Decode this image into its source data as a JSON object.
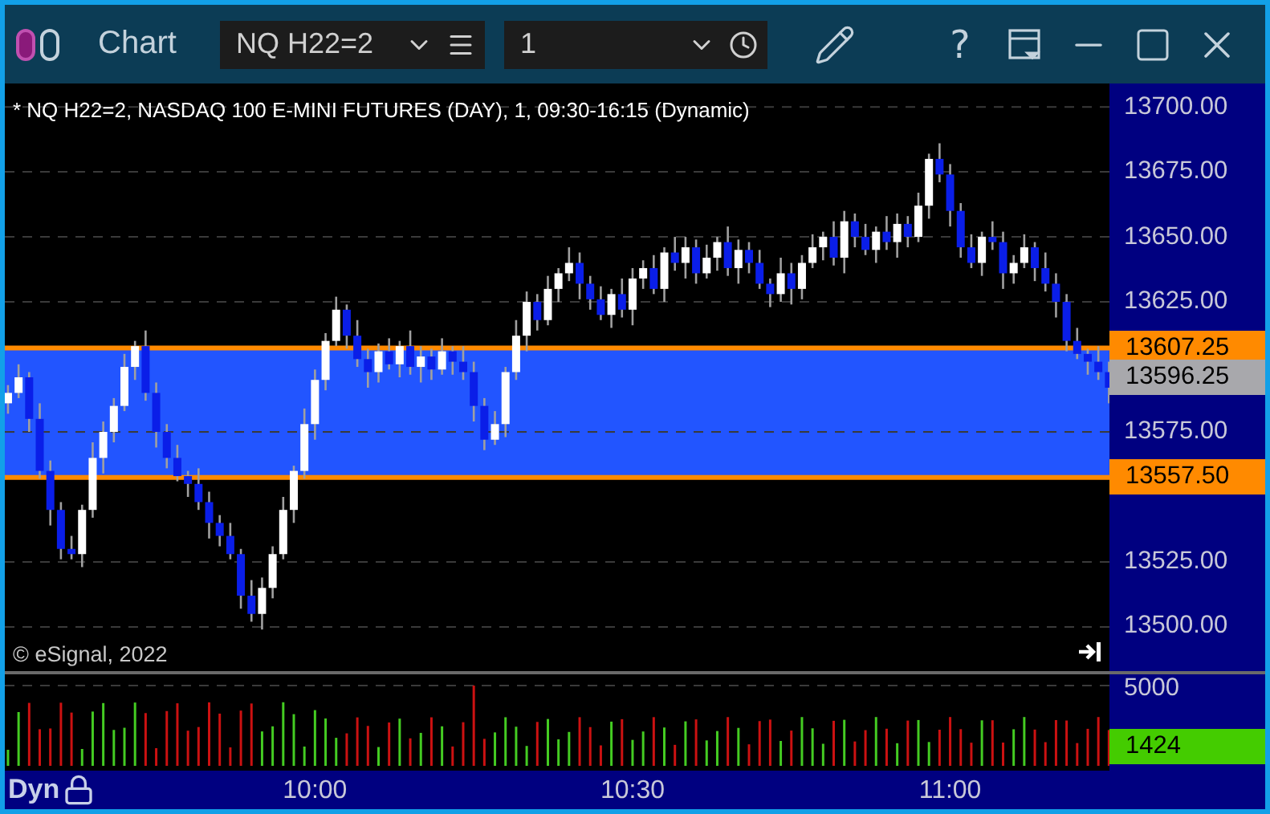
{
  "window": {
    "title": "Chart",
    "help": "?"
  },
  "symbol_field": {
    "value": "NQ H22=2"
  },
  "interval_field": {
    "value": "1"
  },
  "chart": {
    "legend": "* NQ H22=2, NASDAQ 100 E-MINI FUTURES (DAY), 1, 09:30-16:15 (Dynamic)",
    "copyright": "© eSignal, 2022",
    "price_labels": [
      {
        "text": "13607.25",
        "kind": "band"
      },
      {
        "text": "13596.25",
        "kind": "last"
      },
      {
        "text": "13557.50",
        "kind": "band"
      }
    ],
    "chart_data": {
      "type": "candlestick",
      "ylim": [
        13483,
        13709
      ],
      "grid": true,
      "bands": [
        {
          "axis": "y",
          "from": 13557.5,
          "to": 13607.25,
          "color": "#2255ff"
        }
      ],
      "ref_lines": [
        {
          "axis": "y",
          "value": 13607.25,
          "color": "#ff8a00"
        },
        {
          "axis": "y",
          "value": 13557.5,
          "color": "#ff8a00"
        }
      ],
      "yticks": [
        {
          "value": 13700,
          "label": "13700.00"
        },
        {
          "value": 13675,
          "label": "13675.00"
        },
        {
          "value": 13650,
          "label": "13650.00"
        },
        {
          "value": 13625,
          "label": "13625.00"
        },
        {
          "value": 13575,
          "label": "13575.00"
        },
        {
          "value": 13525,
          "label": "13525.00"
        },
        {
          "value": 13500,
          "label": "13500.00"
        }
      ],
      "categories": [
        null,
        null,
        null,
        null,
        null,
        null,
        null,
        null,
        null,
        null,
        null,
        null,
        null,
        null,
        null,
        null,
        null,
        null,
        null,
        null,
        null,
        null,
        null,
        null,
        null,
        null,
        null,
        null,
        null,
        null,
        null,
        null,
        null,
        null,
        null,
        null,
        null,
        null,
        null,
        null,
        null,
        null,
        null,
        null,
        null,
        null,
        null,
        null,
        null,
        null,
        null,
        null,
        null,
        null,
        null,
        null,
        null,
        null,
        null,
        null,
        null,
        null,
        null,
        null,
        null,
        null,
        null,
        null,
        null,
        null,
        null,
        null,
        null,
        null,
        null,
        null,
        null,
        null,
        null,
        null,
        null,
        null,
        null,
        null,
        null,
        null,
        null,
        null,
        null,
        null,
        null,
        null,
        null,
        null,
        null,
        null,
        null,
        null,
        null,
        null,
        null,
        null,
        null,
        null,
        null
      ],
      "ohlc": [
        [
          13586,
          13593,
          13582,
          13590
        ],
        [
          13590,
          13601,
          13588,
          13596
        ],
        [
          13596,
          13598,
          13575,
          13580
        ],
        [
          13580,
          13586,
          13557,
          13560
        ],
        [
          13560,
          13564,
          13539,
          13545
        ],
        [
          13545,
          13548,
          13526,
          13530
        ],
        [
          13530,
          13535,
          13526,
          13528
        ],
        [
          13528,
          13547,
          13523,
          13545
        ],
        [
          13545,
          13571,
          13542,
          13565
        ],
        [
          13565,
          13579,
          13559,
          13575
        ],
        [
          13575,
          13588,
          13571,
          13585
        ],
        [
          13585,
          13605,
          13583,
          13600
        ],
        [
          13600,
          13610,
          13595,
          13608
        ],
        [
          13608,
          13614,
          13587,
          13590
        ],
        [
          13590,
          13594,
          13569,
          13575
        ],
        [
          13575,
          13578,
          13561,
          13565
        ],
        [
          13565,
          13570,
          13556,
          13558
        ],
        [
          13558,
          13560,
          13550,
          13555
        ],
        [
          13555,
          13561,
          13545,
          13548
        ],
        [
          13548,
          13552,
          13534,
          13540
        ],
        [
          13540,
          13543,
          13531,
          13535
        ],
        [
          13535,
          13540,
          13526,
          13528
        ],
        [
          13528,
          13530,
          13507,
          13512
        ],
        [
          13512,
          13518,
          13502,
          13505
        ],
        [
          13505,
          13519,
          13499,
          13515
        ],
        [
          13515,
          13531,
          13511,
          13528
        ],
        [
          13528,
          13550,
          13526,
          13545
        ],
        [
          13545,
          13562,
          13540,
          13560
        ],
        [
          13560,
          13584,
          13557,
          13578
        ],
        [
          13578,
          13599,
          13572,
          13595
        ],
        [
          13595,
          13613,
          13591,
          13610
        ],
        [
          13610,
          13627,
          13608,
          13622
        ],
        [
          13622,
          13624,
          13607,
          13612
        ],
        [
          13612,
          13618,
          13600,
          13603
        ],
        [
          13603,
          13607,
          13592,
          13598
        ],
        [
          13598,
          13609,
          13594,
          13606
        ],
        [
          13606,
          13611,
          13599,
          13601
        ],
        [
          13601,
          13610,
          13596,
          13608
        ],
        [
          13608,
          13614,
          13597,
          13600
        ],
        [
          13600,
          13608,
          13594,
          13604
        ],
        [
          13604,
          13607,
          13595,
          13599
        ],
        [
          13599,
          13611,
          13597,
          13606
        ],
        [
          13606,
          13608,
          13597,
          13602
        ],
        [
          13602,
          13608,
          13595,
          13598
        ],
        [
          13598,
          13602,
          13579,
          13585
        ],
        [
          13585,
          13588,
          13568,
          13572
        ],
        [
          13572,
          13583,
          13570,
          13578
        ],
        [
          13578,
          13600,
          13573,
          13598
        ],
        [
          13598,
          13618,
          13595,
          13612
        ],
        [
          13612,
          13629,
          13606,
          13625
        ],
        [
          13625,
          13628,
          13614,
          13618
        ],
        [
          13618,
          13635,
          13616,
          13630
        ],
        [
          13630,
          13638,
          13625,
          13636
        ],
        [
          13636,
          13646,
          13633,
          13640
        ],
        [
          13640,
          13644,
          13626,
          13632
        ],
        [
          13632,
          13635,
          13622,
          13626
        ],
        [
          13626,
          13631,
          13618,
          13620
        ],
        [
          13620,
          13630,
          13615,
          13628
        ],
        [
          13628,
          13634,
          13619,
          13622
        ],
        [
          13622,
          13638,
          13616,
          13634
        ],
        [
          13634,
          13641,
          13630,
          13638
        ],
        [
          13638,
          13643,
          13628,
          13630
        ],
        [
          13630,
          13646,
          13625,
          13644
        ],
        [
          13644,
          13650,
          13637,
          13640
        ],
        [
          13640,
          13650,
          13634,
          13646
        ],
        [
          13646,
          13649,
          13632,
          13636
        ],
        [
          13636,
          13647,
          13634,
          13642
        ],
        [
          13642,
          13650,
          13637,
          13648
        ],
        [
          13648,
          13654,
          13635,
          13638
        ],
        [
          13638,
          13649,
          13632,
          13645
        ],
        [
          13645,
          13648,
          13636,
          13640
        ],
        [
          13640,
          13645,
          13630,
          13632
        ],
        [
          13632,
          13634,
          13623,
          13628
        ],
        [
          13628,
          13642,
          13625,
          13636
        ],
        [
          13636,
          13640,
          13624,
          13630
        ],
        [
          13630,
          13643,
          13626,
          13640
        ],
        [
          13640,
          13651,
          13638,
          13646
        ],
        [
          13646,
          13652,
          13641,
          13650
        ],
        [
          13650,
          13656,
          13639,
          13642
        ],
        [
          13642,
          13660,
          13636,
          13656
        ],
        [
          13656,
          13659,
          13646,
          13650
        ],
        [
          13650,
          13655,
          13643,
          13645
        ],
        [
          13645,
          13654,
          13640,
          13652
        ],
        [
          13652,
          13658,
          13645,
          13648
        ],
        [
          13648,
          13659,
          13642,
          13655
        ],
        [
          13655,
          13658,
          13646,
          13650
        ],
        [
          13650,
          13667,
          13648,
          13662
        ],
        [
          13662,
          13682,
          13657,
          13680
        ],
        [
          13680,
          13686,
          13671,
          13674
        ],
        [
          13674,
          13678,
          13654,
          13660
        ],
        [
          13660,
          13663,
          13642,
          13646
        ],
        [
          13646,
          13651,
          13638,
          13640
        ],
        [
          13640,
          13652,
          13635,
          13650
        ],
        [
          13650,
          13656,
          13645,
          13648
        ],
        [
          13648,
          13652,
          13630,
          13636
        ],
        [
          13636,
          13643,
          13632,
          13640
        ],
        [
          13640,
          13651,
          13638,
          13646
        ],
        [
          13646,
          13648,
          13633,
          13638
        ],
        [
          13638,
          13644,
          13629,
          13632
        ],
        [
          13632,
          13636,
          13619,
          13625
        ],
        [
          13625,
          13628,
          13606,
          13610
        ],
        [
          13610,
          13615,
          13603,
          13605
        ],
        [
          13605,
          13607,
          13597,
          13602
        ],
        [
          13602,
          13608,
          13595,
          13598
        ],
        [
          13598,
          13602,
          13586,
          13592
        ]
      ]
    }
  },
  "volume": {
    "tick": "5000",
    "last": "1424"
  },
  "time_axis": {
    "mode": "Dyn",
    "labels": [
      "10:00",
      "10:30",
      "11:00"
    ]
  }
}
